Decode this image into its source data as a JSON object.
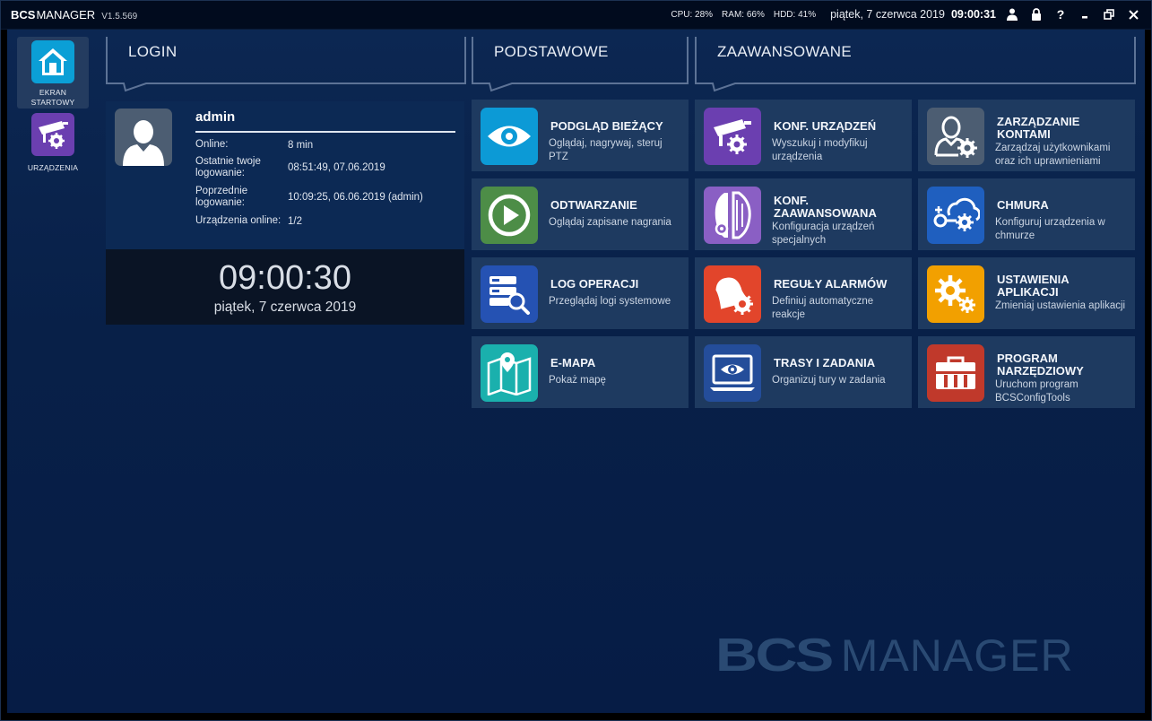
{
  "titlebar": {
    "brand": "BCS",
    "product": "MANAGER",
    "version": "V1.5.569",
    "cpu": "CPU:  28%",
    "ram": "RAM:  66%",
    "hdd": "HDD:  41%",
    "date": "piątek, 7 czerwca 2019",
    "time": "09:00:31",
    "icons": [
      "user-icon",
      "lock-icon",
      "help-icon",
      "minimize-icon",
      "restore-icon",
      "close-icon"
    ]
  },
  "sidebar": {
    "items": [
      {
        "label_line1": "EKRAN",
        "label_line2": "STARTOWY",
        "icon": "home-icon",
        "color": "#0b9fd6",
        "active": true
      },
      {
        "label_line1": "URZĄDZENIA",
        "label_line2": "",
        "icon": "camera-gear-icon",
        "color": "#6b3fb0",
        "active": false
      }
    ]
  },
  "sections": {
    "login": "LOGIN",
    "basic": "PODSTAWOWE",
    "advanced": "ZAAWANSOWANE"
  },
  "login": {
    "username": "admin",
    "rows": [
      {
        "key": "Online:",
        "value": "8 min"
      },
      {
        "key": "Ostatnie twoje logowanie:",
        "value": "08:51:49, 07.06.2019"
      },
      {
        "key": "Poprzednie logowanie:",
        "value": "10:09:25, 06.06.2019 (admin)"
      },
      {
        "key": "Urządzenia online:",
        "value": "1/2"
      }
    ],
    "clock_time": "09:00:30",
    "clock_date": "piątek, 7 czerwca 2019"
  },
  "tiles": {
    "live": {
      "title": "PODGLĄD BIEŻĄCY",
      "desc": "Oglądaj, nagrywaj, steruj PTZ",
      "icon": "eye-icon",
      "color": "#0c9ad6"
    },
    "playback": {
      "title": "ODTWARZANIE",
      "desc": "Oglądaj zapisane nagrania",
      "icon": "play-icon",
      "color": "#4d8d47"
    },
    "log": {
      "title": "LOG OPERACJI",
      "desc": "Przeglądaj logi systemowe",
      "icon": "log-search-icon",
      "color": "#2552b3"
    },
    "emap": {
      "title": "E-MAPA",
      "desc": "Pokaż mapę",
      "icon": "map-pin-icon",
      "color": "#1ab0ad"
    },
    "devconf": {
      "title": "KONF. URZĄDZEŃ",
      "desc": "Wyszukuj i modyfikuj urządzenia",
      "icon": "camera-gear-icon",
      "color": "#6b3fb0"
    },
    "advconf": {
      "title_line1": "KONF.",
      "title_line2": "ZAAWANSOWANA",
      "desc": "Konfiguracja urządzeń specjalnych",
      "icon": "advanced-config-icon",
      "color": "#8a5fc4"
    },
    "alarms": {
      "title": "REGUŁY ALARMÓW",
      "desc": "Definiuj automatyczne reakcje",
      "icon": "alarm-bell-gear-icon",
      "color": "#e2452b"
    },
    "tours": {
      "title": "TRASY I ZADANIA",
      "desc": "Organizuj tury w zadania",
      "icon": "monitor-eye-icon",
      "color": "#244d9a"
    },
    "accounts": {
      "title_line1": "ZARZĄDZANIE",
      "title_line2": "KONTAMI",
      "desc": "Zarządzaj użytkownikami oraz ich uprawnieniami",
      "icon": "user-gear-icon",
      "color": "#4c5d72"
    },
    "cloud": {
      "title": "CHMURA",
      "desc": "Konfiguruj urządzenia w chmurze",
      "icon": "cloud-gear-icon",
      "color": "#1f5fbf"
    },
    "appsettings": {
      "title_line1": "USTAWIENIA",
      "title_line2": "APLIKACJI",
      "desc": "Zmieniaj ustawienia aplikacji",
      "icon": "gears-icon",
      "color": "#f2a000"
    },
    "tools": {
      "title_line1": "PROGRAM",
      "title_line2": "NARZĘDZIOWY",
      "desc": "Uruchom program BCSConfigTools",
      "icon": "toolbox-icon",
      "color": "#c0392b"
    }
  },
  "watermark": {
    "brand": "BCS",
    "product": "MANAGER"
  }
}
